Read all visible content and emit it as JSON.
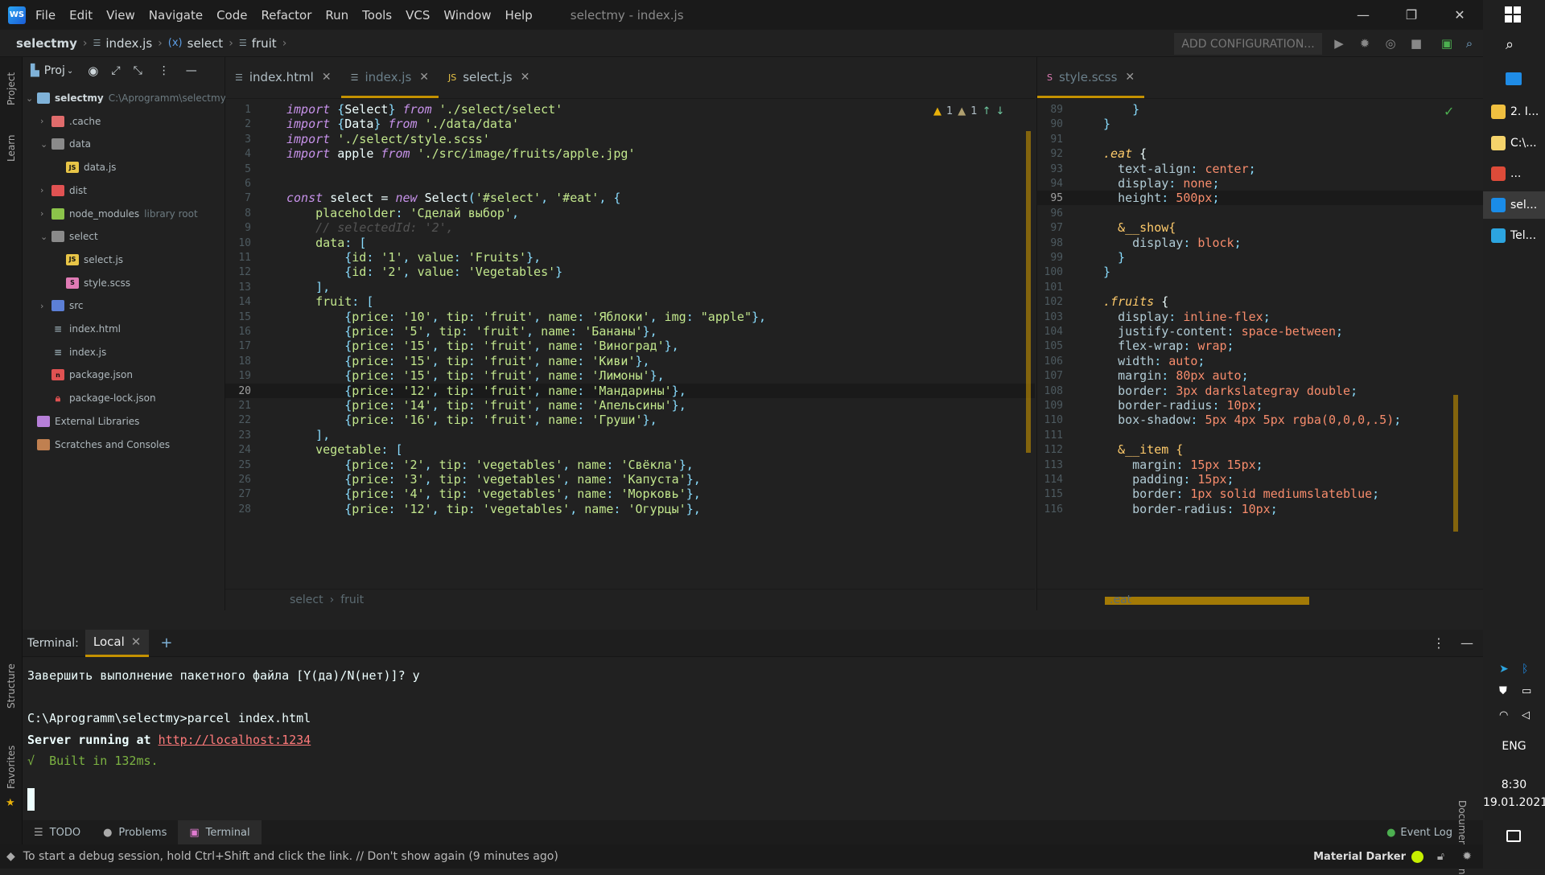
{
  "app": {
    "menu": [
      "File",
      "Edit",
      "View",
      "Navigate",
      "Code",
      "Refactor",
      "Run",
      "Tools",
      "VCS",
      "Window",
      "Help"
    ],
    "window_title": "selectmy - index.js",
    "logo_text": "WS"
  },
  "navbar": {
    "crumbs": [
      "selectmy",
      "index.js",
      "select",
      "fruit"
    ],
    "add_config": "ADD CONFIGURATION..."
  },
  "sidebar_strip": {
    "project": "Project",
    "learn": "Learn",
    "structure": "Structure",
    "favorites": "Favorites"
  },
  "project_panel": {
    "title": "Proj",
    "tree": [
      {
        "label": "selectmy",
        "extra": "C:\\Aprogramm\\selectmy",
        "indent": 0,
        "arrow": "down",
        "icon": "folder",
        "bold": true
      },
      {
        "label": ".cache",
        "indent": 1,
        "arrow": "right",
        "icon": "folder-cache"
      },
      {
        "label": "data",
        "indent": 1,
        "arrow": "down",
        "icon": "folder-data"
      },
      {
        "label": "data.js",
        "indent": 2,
        "arrow": "",
        "icon": "js"
      },
      {
        "label": "dist",
        "indent": 1,
        "arrow": "right",
        "icon": "folder-dist"
      },
      {
        "label": "node_modules",
        "extra": "library root",
        "indent": 1,
        "arrow": "right",
        "icon": "folder-node"
      },
      {
        "label": "select",
        "indent": 1,
        "arrow": "down",
        "icon": "folder-plain"
      },
      {
        "label": "select.js",
        "indent": 2,
        "arrow": "",
        "icon": "js"
      },
      {
        "label": "style.scss",
        "indent": 2,
        "arrow": "",
        "icon": "sass"
      },
      {
        "label": "src",
        "indent": 1,
        "arrow": "right",
        "icon": "folder-src"
      },
      {
        "label": "index.html",
        "indent": 1,
        "arrow": "",
        "icon": "html"
      },
      {
        "label": "index.js",
        "indent": 1,
        "arrow": "",
        "icon": "list"
      },
      {
        "label": "package.json",
        "indent": 1,
        "arrow": "",
        "icon": "npm"
      },
      {
        "label": "package-lock.json",
        "indent": 1,
        "arrow": "",
        "icon": "lock"
      },
      {
        "label": "External Libraries",
        "indent": 0,
        "arrow": "",
        "icon": "lib"
      },
      {
        "label": "Scratches and Consoles",
        "indent": 0,
        "arrow": "",
        "icon": "scratch"
      }
    ]
  },
  "editor_left": {
    "tabs": [
      {
        "label": "index.html",
        "active": false
      },
      {
        "label": "index.js",
        "active": true
      },
      {
        "label": "select.js",
        "active": false
      }
    ],
    "inspections": {
      "warnings": "1",
      "weak_warnings": "1"
    },
    "breadcrumb": [
      "select",
      "fruit"
    ],
    "current_line": 20,
    "lines": [
      {
        "n": 1,
        "code": "import {Select} from './select/select'"
      },
      {
        "n": 2,
        "code": "import {Data} from './data/data'"
      },
      {
        "n": 3,
        "code": "import './select/style.scss'"
      },
      {
        "n": 4,
        "code": "import apple from './src/image/fruits/apple.jpg'"
      },
      {
        "n": 5,
        "code": ""
      },
      {
        "n": 6,
        "code": ""
      },
      {
        "n": 7,
        "code": "const select = new Select('#select', '#eat', {"
      },
      {
        "n": 8,
        "code": "    placeholder: 'Сделай выбор',"
      },
      {
        "n": 9,
        "code": "    // selectedId: '2',"
      },
      {
        "n": 10,
        "code": "    data: ["
      },
      {
        "n": 11,
        "code": "        {id: '1', value: 'Fruits'},"
      },
      {
        "n": 12,
        "code": "        {id: '2', value: 'Vegetables'}"
      },
      {
        "n": 13,
        "code": "    ],"
      },
      {
        "n": 14,
        "code": "    fruit: ["
      },
      {
        "n": 15,
        "code": "        {price: '10', tip: 'fruit', name: 'Яблоки', img: \"apple\"},"
      },
      {
        "n": 16,
        "code": "        {price: '5', tip: 'fruit', name: 'Бананы'},"
      },
      {
        "n": 17,
        "code": "        {price: '15', tip: 'fruit', name: 'Виноград'},"
      },
      {
        "n": 18,
        "code": "        {price: '15', tip: 'fruit', name: 'Киви'},"
      },
      {
        "n": 19,
        "code": "        {price: '15', tip: 'fruit', name: 'Лимоны'},"
      },
      {
        "n": 20,
        "code": "        {price: '12', tip: 'fruit', name: 'Мандарины'},"
      },
      {
        "n": 21,
        "code": "        {price: '14', tip: 'fruit', name: 'Апельсины'},"
      },
      {
        "n": 22,
        "code": "        {price: '16', tip: 'fruit', name: 'Груши'},"
      },
      {
        "n": 23,
        "code": "    ],"
      },
      {
        "n": 24,
        "code": "    vegetable: ["
      },
      {
        "n": 25,
        "code": "        {price: '2', tip: 'vegetables', name: 'Свёкла'},"
      },
      {
        "n": 26,
        "code": "        {price: '3', tip: 'vegetables', name: 'Капуста'},"
      },
      {
        "n": 27,
        "code": "        {price: '4', tip: 'vegetables', name: 'Морковь'},"
      },
      {
        "n": 28,
        "code": "        {price: '12', tip: 'vegetables', name: 'Огурцы'},"
      }
    ]
  },
  "editor_right": {
    "tabs": [
      {
        "label": "style.scss",
        "active": true
      }
    ],
    "breadcrumb": [
      ".eat"
    ],
    "current_line": 95,
    "lines": [
      {
        "n": 89,
        "code": "    }"
      },
      {
        "n": 90,
        "code": "}"
      },
      {
        "n": 91,
        "code": ""
      },
      {
        "n": 92,
        "code": ".eat {"
      },
      {
        "n": 93,
        "code": "  text-align: center;"
      },
      {
        "n": 94,
        "code": "  display: none;"
      },
      {
        "n": 95,
        "code": "  height: 500px;"
      },
      {
        "n": 96,
        "code": ""
      },
      {
        "n": 97,
        "code": "  &__show{"
      },
      {
        "n": 98,
        "code": "    display: block;"
      },
      {
        "n": 99,
        "code": "  }"
      },
      {
        "n": 100,
        "code": "}"
      },
      {
        "n": 101,
        "code": ""
      },
      {
        "n": 102,
        "code": ".fruits {"
      },
      {
        "n": 103,
        "code": "  display: inline-flex;"
      },
      {
        "n": 104,
        "code": "  justify-content: space-between;"
      },
      {
        "n": 105,
        "code": "  flex-wrap: wrap;"
      },
      {
        "n": 106,
        "code": "  width: auto;"
      },
      {
        "n": 107,
        "code": "  margin: 80px auto;"
      },
      {
        "n": 108,
        "code": "  border: 3px darkslategray double;"
      },
      {
        "n": 109,
        "code": "  border-radius: 10px;"
      },
      {
        "n": 110,
        "code": "  box-shadow: 5px 4px 5px rgba(0,0,0,.5);"
      },
      {
        "n": 111,
        "code": ""
      },
      {
        "n": 112,
        "code": "  &__item {"
      },
      {
        "n": 113,
        "code": "    margin: 15px 15px;"
      },
      {
        "n": 114,
        "code": "    padding: 15px;"
      },
      {
        "n": 115,
        "code": "    border: 1px solid mediumslateblue;"
      },
      {
        "n": 116,
        "code": "    border-radius: 10px;"
      }
    ]
  },
  "terminal": {
    "title": "Terminal:",
    "tab": "Local",
    "lines": [
      {
        "text": "Завершить выполнение пакетного файла [Y(да)/N(нет)]? y",
        "kind": "plain"
      },
      {
        "text": "",
        "kind": "plain"
      },
      {
        "text": "C:\\Aprogramm\\selectmy>parcel index.html",
        "kind": "plain"
      },
      {
        "text": "Server running at ",
        "link": "http://localhost:1234",
        "kind": "server"
      },
      {
        "text": "√  Built in 132ms.",
        "kind": "success"
      }
    ]
  },
  "bottom_tabs": [
    "TODO",
    "Problems",
    "Terminal"
  ],
  "status": {
    "message": "To start a debug session, hold Ctrl+Shift and click the link. // Don't show again (9 minutes ago)",
    "theme": "Material Darker",
    "event_log": "Event Log",
    "documentation": "Documentation"
  },
  "taskbar": {
    "items": [
      {
        "label": "2. I...",
        "color": "#f0c040"
      },
      {
        "label": "C:\\...",
        "color": "#f5d36b"
      },
      {
        "label": "...",
        "color": "#dd4b39"
      },
      {
        "label": "sel...",
        "color": "#1a8ce8"
      },
      {
        "label": "Tel...",
        "color": "#2ca5e0"
      }
    ],
    "lang": "ENG",
    "time": "8:30",
    "date": "19.01.2021"
  },
  "colors": {
    "keyword": "#c792ea",
    "string": "#c3e88d",
    "property": "#89ddff",
    "accent": "#c49100"
  }
}
